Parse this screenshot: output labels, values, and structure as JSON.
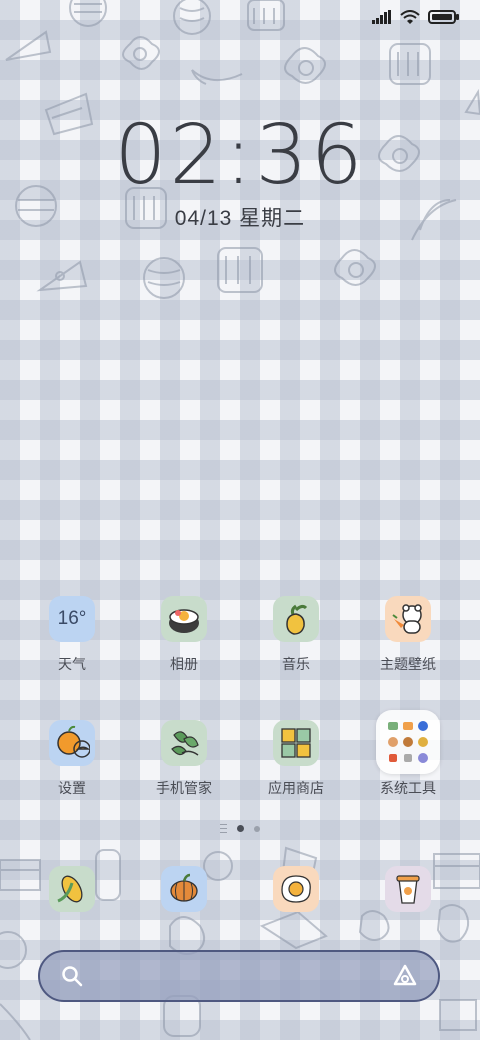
{
  "status_bar": {
    "icons": [
      "signal-icon",
      "wifi-icon",
      "battery-icon"
    ]
  },
  "lock": {
    "time": "02:36",
    "date": "04/13 星期二"
  },
  "apps_row1": [
    {
      "label": "天气",
      "icon": "weather-icon",
      "badge": "16°"
    },
    {
      "label": "相册",
      "icon": "gallery-icon"
    },
    {
      "label": "音乐",
      "icon": "music-icon"
    },
    {
      "label": "主题壁纸",
      "icon": "themes-icon"
    }
  ],
  "apps_row2": [
    {
      "label": "设置",
      "icon": "settings-icon"
    },
    {
      "label": "手机管家",
      "icon": "security-icon"
    },
    {
      "label": "应用商店",
      "icon": "app-store-icon"
    },
    {
      "label": "系统工具",
      "icon": "system-tools-folder"
    }
  ],
  "dock": [
    {
      "icon": "corn-icon"
    },
    {
      "icon": "pumpkin-icon"
    },
    {
      "icon": "fried-egg-icon"
    },
    {
      "icon": "coffee-cup-icon"
    }
  ],
  "pager": {
    "pages": 2,
    "active": 1
  },
  "search": {
    "left_icon": "search-icon",
    "right_icon": "assistant-icon"
  },
  "colors": {
    "gingham": "#bcc4d2",
    "text": "#3a3d44",
    "search_bar": "#96a0be",
    "search_border": "#4e5880"
  }
}
